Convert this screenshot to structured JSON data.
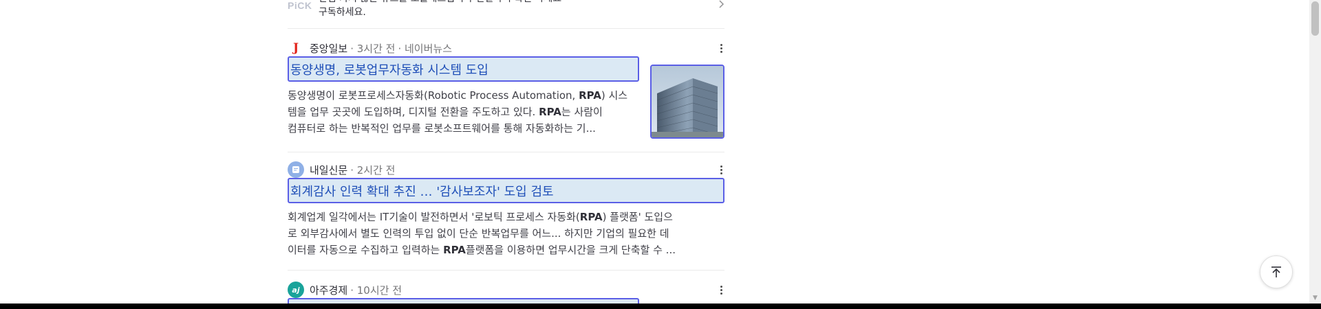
{
  "top_item": {
    "logo": "PiCK",
    "line1": "관심 가지 않는 뉴스를 노출해드립니다 연결하여 확인 하세요",
    "line2": "구독하세요."
  },
  "articles": [
    {
      "press": "중앙일보",
      "press_logo": "J",
      "time": "· 3시간 전",
      "via": "· 네이버뉴스",
      "title": "동양생명, 로봇업무자동화 시스템 도입",
      "desc": [
        [
          "동양생명이 로봇프로세스자동화(Robotic Process Automation, ",
          "RPA",
          ") 시스"
        ],
        [
          "템을 업무 곳곳에 도입하며, 디지털 전환을 주도하고 있다. ",
          "RPA",
          "는 사람이"
        ],
        [
          "컴퓨터로 하는 반복적인 업무를 로봇소프트웨어를 통해 자동화하는 기...",
          "",
          ""
        ]
      ],
      "has_thumbnail": true
    },
    {
      "press": "내일신문",
      "press_logo": "내",
      "time": "· 2시간 전",
      "via": "",
      "title": "회계감사 인력 확대 추진 … '감사보조자' 도입 검토",
      "desc": [
        [
          "회계업계 일각에서는 IT기술이 발전하면서 '로보틱 프로세스 자동화(",
          "RPA",
          ") 플랫폼' 도입으"
        ],
        [
          "로 외부감사에서 별도 인력의 투입 없이 단순 반복업무를 어느... 하지만 기업의 필요한 데",
          "",
          ""
        ],
        [
          "이터를 자동으로 수집하고 입력하는 ",
          "RPA",
          "플랫폼을 이용하면 업무시간을 크게 단축할 수 ..."
        ]
      ],
      "has_thumbnail": false
    },
    {
      "press": "아주경제",
      "press_logo": "aj",
      "time": "· 10시간 전",
      "via": "",
      "title": "",
      "desc": [],
      "has_thumbnail": false
    }
  ],
  "colors": {
    "title_highlight_bg": "#dbe9f4",
    "title_highlight_border": "#5a5ee6",
    "title_text": "#1f4fb8"
  },
  "icons": {
    "more": "vertical-ellipsis-icon",
    "scroll_top": "arrow-up-icon",
    "chevron": "chevron-right-icon"
  }
}
